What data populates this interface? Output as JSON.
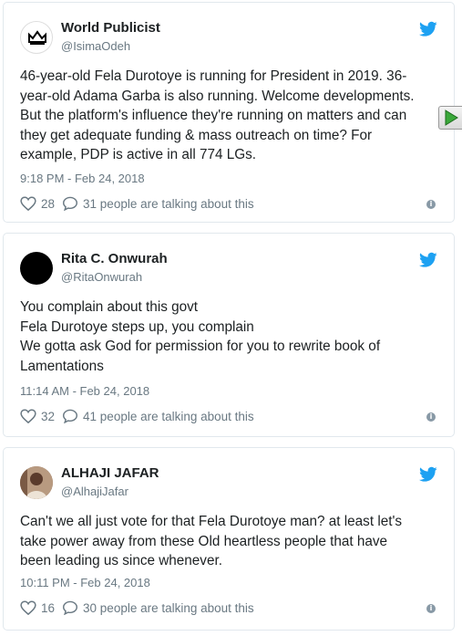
{
  "tweets": [
    {
      "name": "World Publicist",
      "handle": "@IsimaOdeh",
      "avatar_icon": "crown-logo",
      "text_lines": [
        "46-year-old Fela Durotoye is running for President in 2019. 36-",
        "year-old Adama Garba is also running. Welcome developments.",
        "But the platform's influence they're running on matters and can",
        "they get adequate funding & mass outreach on time? For",
        "example, PDP is active in all 774 LGs."
      ],
      "timestamp": "9:18 PM - Feb 24, 2018",
      "likes": "28",
      "talking": "31 people are talking about this"
    },
    {
      "name": "Rita C. Onwurah",
      "handle": "@RitaOnwurah",
      "avatar_icon": "black-circle",
      "text_lines": [
        "You complain about this govt",
        "Fela Durotoye steps up, you complain",
        "We gotta ask God for permission for you to rewrite book of",
        "Lamentations"
      ],
      "timestamp": "11:14 AM - Feb 24, 2018",
      "likes": "32",
      "talking": "41 people are talking about this"
    },
    {
      "name": "ALHAJI JAFAR",
      "handle": "@AlhajiJafar",
      "avatar_icon": "profile-photo",
      "text_lines": [
        "Can't we all just vote for that Fela Durotoye man? at least let's",
        "take power away from these Old heartless people that have",
        "been leading us since whenever."
      ],
      "timestamp": "10:11 PM - Feb 24, 2018",
      "likes": "16",
      "talking": "30 people are talking about this"
    }
  ],
  "colors": {
    "twitter_blue": "#1da1f2",
    "text": "#1c2022",
    "muted": "#697882",
    "border": "#e1e8ed"
  }
}
